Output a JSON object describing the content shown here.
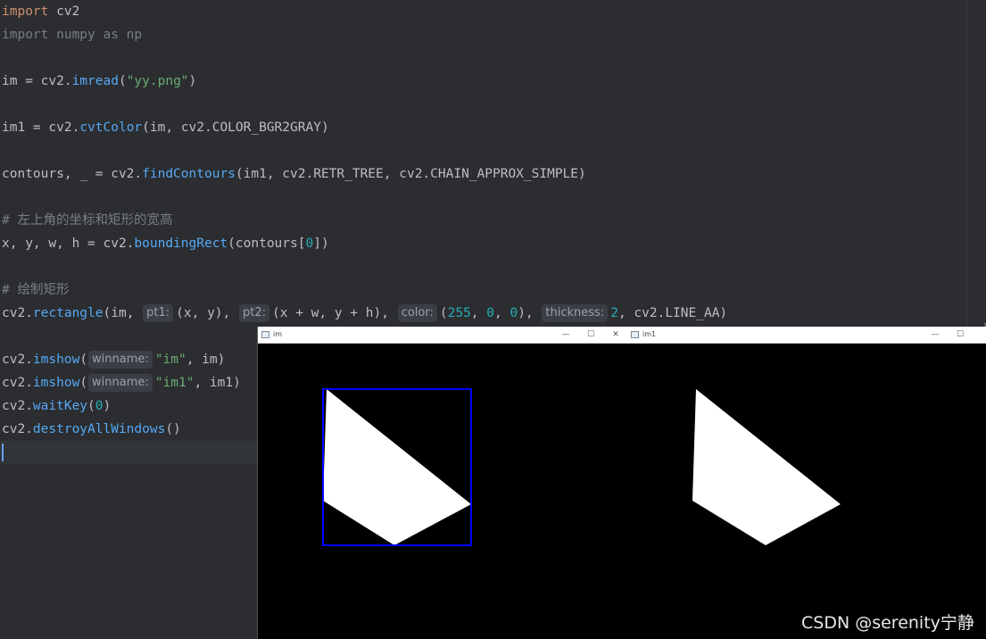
{
  "editor": {
    "lines": {
      "l1_kw": "import",
      "l1_rest": " cv2",
      "l2": "import numpy as np",
      "l3_a": "im = cv2.",
      "l3_fn": "imread",
      "l3_b": "(",
      "l3_str": "\"yy.png\"",
      "l3_c": ")",
      "l4_a": "im1 = cv2.",
      "l4_fn": "cvtColor",
      "l4_b": "(im, cv2.COLOR_BGR2GRAY)",
      "l5_a": "contours, _ = cv2.",
      "l5_fn": "findContours",
      "l5_b": "(im1, cv2.RETR_TREE, cv2.CHAIN_APPROX_SIMPLE)",
      "l6_comment": "# 左上角的坐标和矩形的宽高",
      "l7_a": "x, y, w, h = cv2.",
      "l7_fn": "boundingRect",
      "l7_b": "(contours[",
      "l7_num": "0",
      "l7_c": "])",
      "l8_comment": "# 绘制矩形",
      "l9_a": "cv2.",
      "l9_fn": "rectangle",
      "l9_b": "(im, ",
      "l9_hint1": "pt1:",
      "l9_c": "(x, y), ",
      "l9_hint2": "pt2:",
      "l9_d": "(x + w, y + h), ",
      "l9_hint3": "color:",
      "l9_e": "(",
      "l9_n1": "255",
      "l9_f": ", ",
      "l9_n2": "0",
      "l9_g": ", ",
      "l9_n3": "0",
      "l9_h": "), ",
      "l9_hint4": "thickness:",
      "l9_n4": "2",
      "l9_i": ", cv2.LINE_AA)",
      "l10_a": "cv2.",
      "l10_fn": "imshow",
      "l10_b": "(",
      "l10_hint": "winname:",
      "l10_str": "\"im\"",
      "l10_c": ", im)",
      "l11_a": "cv2.",
      "l11_fn": "imshow",
      "l11_b": "(",
      "l11_hint": "winname:",
      "l11_str": "\"im1\"",
      "l11_c": ", im1)",
      "l12_a": "cv2.",
      "l12_fn": "waitKey",
      "l12_b": "(",
      "l12_num": "0",
      "l12_c": ")",
      "l13_a": "cv2.",
      "l13_fn": "destroyAllWindows",
      "l13_b": "()"
    }
  },
  "windows": {
    "im": {
      "title": "im",
      "minimize": "—",
      "maximize": "☐",
      "close": "✕"
    },
    "im1": {
      "title": "im1",
      "minimize": "—",
      "maximize": "☐",
      "close": ""
    }
  },
  "colors": {
    "rect_stroke": "#0000ff",
    "shape_fill": "#ffffff",
    "canvas_bg": "#000000"
  },
  "watermark": "CSDN @serenity宁静"
}
